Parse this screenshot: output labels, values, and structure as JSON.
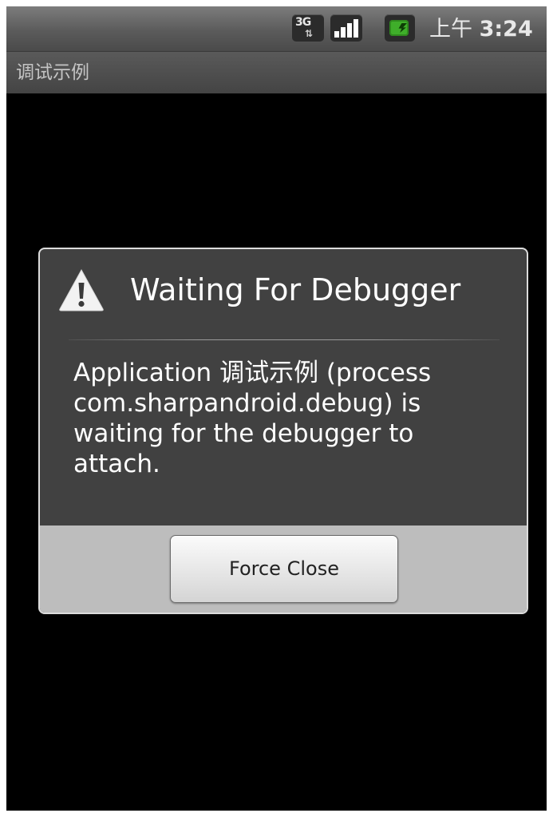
{
  "status_bar": {
    "network_label": "3G",
    "network_arrows": "⇅",
    "network_icon": "3g-data-icon",
    "signal_icon": "signal-strength-icon",
    "battery_icon": "battery-charging-icon",
    "clock_ampm": "上午",
    "clock_time": "3:24"
  },
  "title_bar": {
    "app_title": "调试示例"
  },
  "dialog": {
    "icon": "warning-icon",
    "title": "Waiting For Debugger",
    "message": "Application 调试示例 (process com.sharpandroid.debug) is waiting for the debugger to attach.",
    "button_label": "Force Close"
  },
  "colors": {
    "screen_background": "#000000",
    "dialog_background": "#414141",
    "dialog_footer": "#bdbdbd",
    "battery_green": "#3fae2a"
  }
}
